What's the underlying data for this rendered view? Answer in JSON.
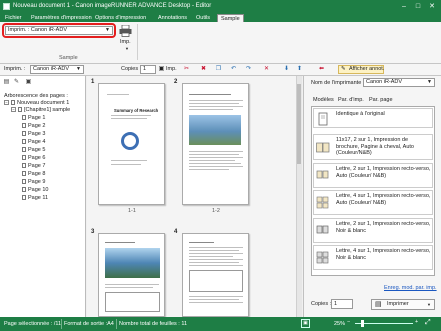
{
  "window": {
    "title": "Nouveau document 1 - Canon imageRUNNER ADVANCE Desktop - Editor",
    "minimize": "–",
    "maximize": "□",
    "close": "✕"
  },
  "ribbon_tabs": [
    "Fichier",
    "Paramètres d'impression",
    "Options d'impression",
    "Annotations",
    "Outils",
    "Sample"
  ],
  "ribbon": {
    "printer_label": "Imprim. :",
    "printer_value": "Canon iR-ADV",
    "print_button_label": "Imp.",
    "group_label": "Sample"
  },
  "toolbar": {
    "printer_label": "Imprim. :",
    "printer_value": "Canon iR-ADV",
    "copies_label": "Copies :",
    "copies_value": "1",
    "print_label": "Imp.",
    "show_annotations": "Afficher annot."
  },
  "left_pane": {
    "title": "Arborescence des pages :",
    "root": "Nouveau document 1",
    "chapter": "[Chapitre1] sample",
    "pages": [
      "Page 1",
      "Page 2",
      "Page 3",
      "Page 4",
      "Page 5",
      "Page 6",
      "Page 7",
      "Page 8",
      "Page 9",
      "Page 10",
      "Page 11"
    ]
  },
  "center": {
    "page_numbers": [
      "1",
      "2",
      "3",
      "4"
    ],
    "labels": [
      "1-1",
      "1-2"
    ],
    "doc_title": "Summary of Research"
  },
  "right_pane": {
    "printer_name_label": "Nom de l'imprimante :",
    "printer_name_value": "Canon iR-ADV",
    "tabs": [
      "Modèles",
      "Par. d'imp.",
      "Par. page"
    ],
    "templates": [
      "Identique à l'original",
      "11x17, 2 sur 1, Impression de brochure, Pagine à cheval, Auto (Couleur/N&B)",
      "Lettre, 2 sur 1, Impression recto-verso, Auto (Couleur/ N&B)",
      "Lettre, 4 sur 1, Impression recto-verso, Auto (Couleur/ N&B)",
      "Lettre, 2 sur 1, Impression recto-verso, Noir & blanc",
      "Lettre, 4 sur 1, Impression recto-verso, Noir & blanc"
    ],
    "register_link": "Enreg. mod. par. imp.",
    "copies_label": "Copies :",
    "copies_value": "1",
    "print_button": "Imprimer"
  },
  "status_bar": {
    "pages_selected": "Page sélectionnée : /11",
    "output_format": "Format de sortie :A4",
    "total_sheets": "Nombre total de feuilles : 11",
    "zoom": "25%"
  }
}
